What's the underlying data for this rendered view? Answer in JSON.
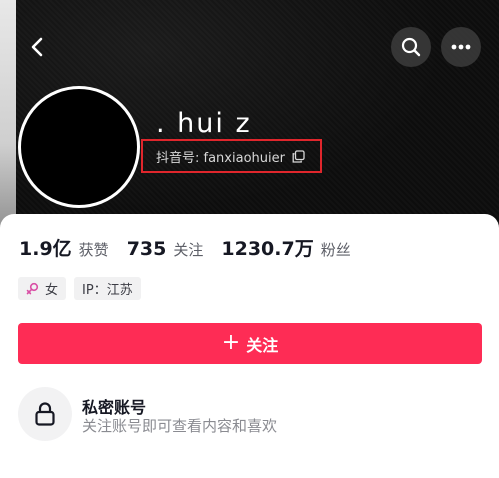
{
  "profile": {
    "nickname": ". hui  z",
    "douyin_id": "抖音号: fanxiaohuier"
  },
  "nav": {
    "back_icon": "chevron-left-icon",
    "search_icon": "search-icon",
    "more_icon": "more-horizontal-icon"
  },
  "stats": [
    {
      "value": "1.9亿",
      "label": "获赞"
    },
    {
      "value": "735",
      "label": "关注"
    },
    {
      "value": "1230.7万",
      "label": "粉丝"
    }
  ],
  "tags": {
    "gender": "女",
    "ip": "IP：江苏"
  },
  "follow_button": {
    "plus": "+",
    "label": "关注"
  },
  "private": {
    "title": "私密账号",
    "description": "关注账号即可查看内容和喜欢"
  },
  "colors": {
    "accent": "#fe2c55",
    "highlight_box": "#e0262c",
    "gender_icon": "#d94fa5"
  }
}
